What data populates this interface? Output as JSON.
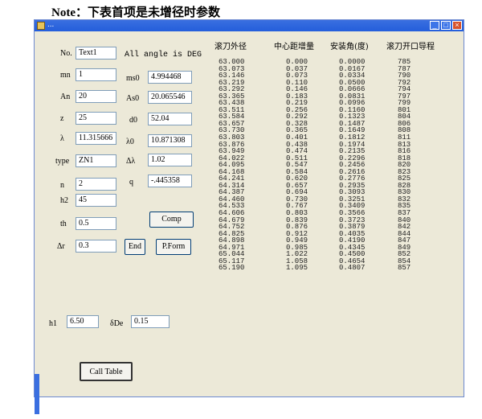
{
  "note": "Note：下表首项是未增径时参数",
  "window": {
    "title": "..."
  },
  "left_labels": {
    "no": "No.",
    "m": "mn",
    "an": "An",
    "z": "z",
    "lambda": "λ",
    "type": "type",
    "n": "n",
    "h2": "h2",
    "th": "th",
    "dr": "Δr"
  },
  "left_values": {
    "no": "Text1",
    "m": "1",
    "an": "20",
    "z": "25",
    "lambda": "11.315666",
    "type": "ZN1",
    "n": "2",
    "h2": "45",
    "th": "0.5",
    "dr": "0.3"
  },
  "angle_note": "All angle is DEG",
  "mid_labels": {
    "ms0": "ms0",
    "as0": "As0",
    "d0": "d0",
    "lambda0": "λ0",
    "dlambda": "Δλ",
    "q": "q"
  },
  "mid_values": {
    "ms0": "4.994468",
    "as0": "20.065546",
    "d0": "52.04",
    "lambda0": "10.871308",
    "dlambda": "1.02",
    "q": "-.445358"
  },
  "buttons": {
    "comp": "Comp",
    "end": "End",
    "pform": "P.Form",
    "call_table": "Call Table"
  },
  "bottom": {
    "h1_label": "h1",
    "h1_value": "6.50",
    "sde_label": "δDe",
    "sde_value": "0.15"
  },
  "table": {
    "headers": [
      "滚刀外径",
      "中心距增量",
      "安装角(度)",
      "滚刀开口导程"
    ],
    "col1": [
      "63.000",
      "63.073",
      "63.146",
      "63.219",
      "63.292",
      "63.365",
      "63.438",
      "63.511",
      "63.584",
      "63.657",
      "63.730",
      "63.803",
      "63.876",
      "63.949",
      "64.022",
      "64.095",
      "64.168",
      "64.241",
      "64.314",
      "64.387",
      "64.460",
      "64.533",
      "64.606",
      "64.679",
      "64.752",
      "64.825",
      "64.898",
      "64.971",
      "65.044",
      "65.117",
      "65.190"
    ],
    "col2": [
      "0.000",
      "0.037",
      "0.073",
      "0.110",
      "0.146",
      "0.183",
      "0.219",
      "0.256",
      "0.292",
      "0.328",
      "0.365",
      "0.401",
      "0.438",
      "0.474",
      "0.511",
      "0.547",
      "0.584",
      "0.620",
      "0.657",
      "0.694",
      "0.730",
      "0.767",
      "0.803",
      "0.839",
      "0.876",
      "0.912",
      "0.949",
      "0.985",
      "1.022",
      "1.058",
      "1.095"
    ],
    "col3": [
      "0.0000",
      "0.0167",
      "0.0334",
      "0.0500",
      "0.0666",
      "0.0831",
      "0.0996",
      "0.1160",
      "0.1323",
      "0.1487",
      "0.1649",
      "0.1812",
      "0.1974",
      "0.2135",
      "0.2296",
      "0.2456",
      "0.2616",
      "0.2776",
      "0.2935",
      "0.3093",
      "0.3251",
      "0.3409",
      "0.3566",
      "0.3723",
      "0.3879",
      "0.4035",
      "0.4190",
      "0.4345",
      "0.4500",
      "0.4654",
      "0.4807"
    ],
    "col4": [
      "785",
      "787",
      "790",
      "792",
      "794",
      "797",
      "799",
      "801",
      "804",
      "806",
      "808",
      "811",
      "813",
      "816",
      "818",
      "820",
      "823",
      "825",
      "828",
      "830",
      "832",
      "835",
      "837",
      "840",
      "842",
      "844",
      "847",
      "849",
      "852",
      "854",
      "857"
    ]
  }
}
